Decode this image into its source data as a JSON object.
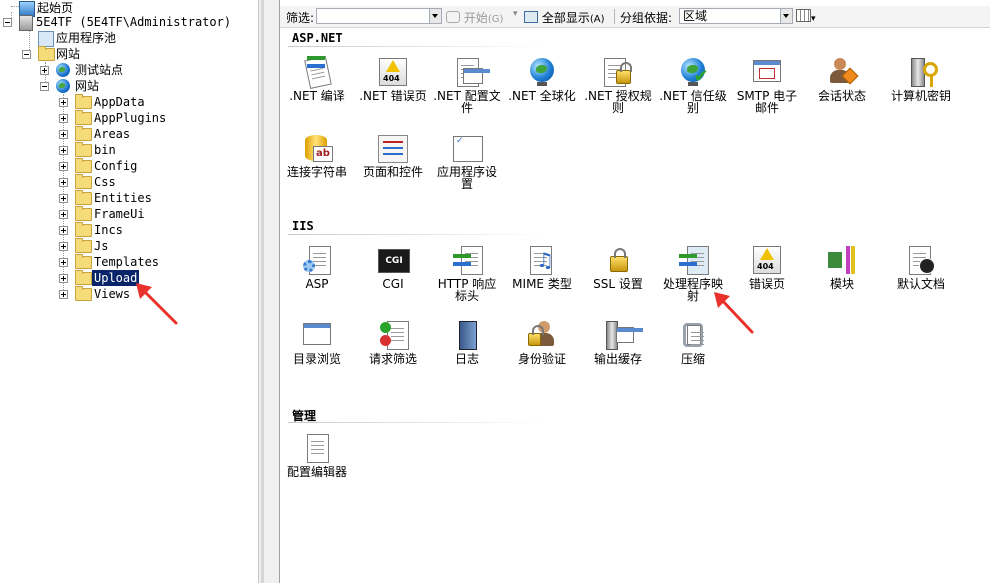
{
  "tree": {
    "start_page": "起始页",
    "server": "5E4TF (5E4TF\\Administrator)",
    "app_pools": "应用程序池",
    "sites": "网站",
    "test_site": "测试站点",
    "site": "网站",
    "folders": [
      "AppData",
      "AppPlugins",
      "Areas",
      "bin",
      "Config",
      "Css",
      "Entities",
      "FrameUi",
      "Incs",
      "Js",
      "Templates",
      "Upload",
      "Views"
    ],
    "selected_folder": "Upload"
  },
  "toolbar": {
    "filter_label": "筛选:",
    "filter_value": "",
    "start_label": "开始",
    "start_key": "(G)",
    "show_all_label": "全部显示",
    "show_all_key": "(A)",
    "group_by_label": "分组依据:",
    "group_by_value": "区域"
  },
  "sections": {
    "aspnet": {
      "title": "ASP.NET",
      "items": [
        {
          "label": ".NET 编译",
          "icon": "compile-icon"
        },
        {
          "label": ".NET 错误页",
          "icon": "error-page-icon"
        },
        {
          "label": ".NET 配置文件",
          "icon": "profile-icon"
        },
        {
          "label": ".NET 全球化",
          "icon": "globe-icon"
        },
        {
          "label": ".NET 授权规则",
          "icon": "authorization-lock-icon"
        },
        {
          "label": ".NET 信任级别",
          "icon": "trust-globe-icon"
        },
        {
          "label": "SMTP 电子邮件",
          "icon": "smtp-mail-icon"
        },
        {
          "label": "会话状态",
          "icon": "session-user-icon"
        },
        {
          "label": "计算机密钥",
          "icon": "machine-key-icon"
        },
        {
          "label": "连接字符串",
          "icon": "connection-string-icon"
        },
        {
          "label": "页面和控件",
          "icon": "pages-controls-icon"
        },
        {
          "label": "应用程序设置",
          "icon": "app-settings-icon"
        }
      ]
    },
    "iis": {
      "title": "IIS",
      "items": [
        {
          "label": "ASP",
          "icon": "asp-icon"
        },
        {
          "label": "CGI",
          "icon": "cgi-icon"
        },
        {
          "label": "HTTP 响应标头",
          "icon": "http-headers-icon"
        },
        {
          "label": "MIME 类型",
          "icon": "mime-types-icon"
        },
        {
          "label": "SSL 设置",
          "icon": "ssl-lock-icon"
        },
        {
          "label": "处理程序映射",
          "icon": "handler-mappings-icon"
        },
        {
          "label": "错误页",
          "icon": "error-pages-icon"
        },
        {
          "label": "模块",
          "icon": "modules-icon"
        },
        {
          "label": "默认文档",
          "icon": "default-document-icon"
        },
        {
          "label": "目录浏览",
          "icon": "directory-browsing-icon"
        },
        {
          "label": "请求筛选",
          "icon": "request-filtering-icon"
        },
        {
          "label": "日志",
          "icon": "logging-icon"
        },
        {
          "label": "身份验证",
          "icon": "authentication-icon"
        },
        {
          "label": "输出缓存",
          "icon": "output-caching-icon"
        },
        {
          "label": "压缩",
          "icon": "compression-icon"
        }
      ]
    },
    "management": {
      "title": "管理",
      "items": [
        {
          "label": "配置编辑器",
          "icon": "configuration-editor-icon"
        }
      ]
    }
  },
  "colors": {
    "selection": "#0a246a",
    "annotation_arrow": "#e8322b"
  }
}
